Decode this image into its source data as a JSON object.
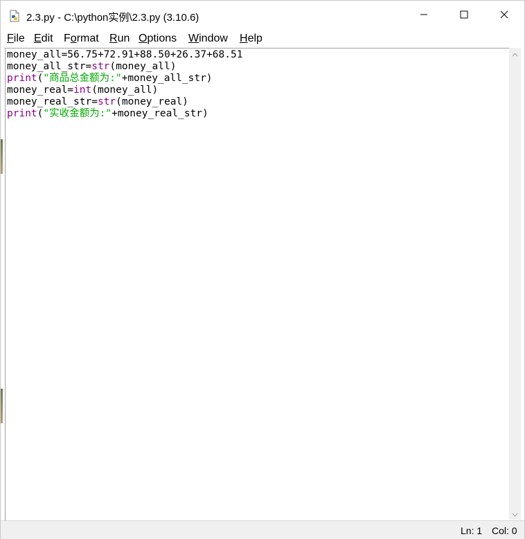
{
  "window": {
    "title": "2.3.py - C:\\python实例\\2.3.py (3.10.6)",
    "icon": "python-file-icon"
  },
  "title_buttons": {
    "minimize_icon": "minimize-icon",
    "maximize_icon": "maximize-icon",
    "close_icon": "close-icon"
  },
  "menu": {
    "items": [
      {
        "accel": "F",
        "rest": "ile"
      },
      {
        "accel": "E",
        "rest": "dit"
      },
      {
        "pre": "F",
        "accel": "o",
        "rest": "rmat"
      },
      {
        "accel": "R",
        "rest": "un"
      },
      {
        "accel": "O",
        "rest": "ptions"
      },
      {
        "accel": "W",
        "rest": "indow"
      },
      {
        "accel": "H",
        "rest": "elp"
      }
    ]
  },
  "editor": {
    "lines": [
      [
        {
          "t": "money_all=56.75+72.91+88.50+26.37+68.51",
          "c": "plain"
        }
      ],
      [
        {
          "t": "money_all_str=",
          "c": "plain"
        },
        {
          "t": "str",
          "c": "kw"
        },
        {
          "t": "(money_all)",
          "c": "plain"
        }
      ],
      [
        {
          "t": "print",
          "c": "kw"
        },
        {
          "t": "(",
          "c": "plain"
        },
        {
          "t": "\"商品总金额为:\"",
          "c": "str"
        },
        {
          "t": "+money_all_str)",
          "c": "plain"
        }
      ],
      [
        {
          "t": "money_real=",
          "c": "plain"
        },
        {
          "t": "int",
          "c": "kw"
        },
        {
          "t": "(money_all)",
          "c": "plain"
        }
      ],
      [
        {
          "t": "money_real_str=",
          "c": "plain"
        },
        {
          "t": "str",
          "c": "kw"
        },
        {
          "t": "(money_real)",
          "c": "plain"
        }
      ],
      [
        {
          "t": "print",
          "c": "kw"
        },
        {
          "t": "(",
          "c": "plain"
        },
        {
          "t": "\"实收金额为:\"",
          "c": "str"
        },
        {
          "t": "+money_real_str)",
          "c": "plain"
        }
      ]
    ]
  },
  "status": {
    "line": "Ln: 1",
    "col": "Col: 0"
  },
  "colors": {
    "keyword": "#900090",
    "string": "#00aa00",
    "text": "#000000"
  }
}
